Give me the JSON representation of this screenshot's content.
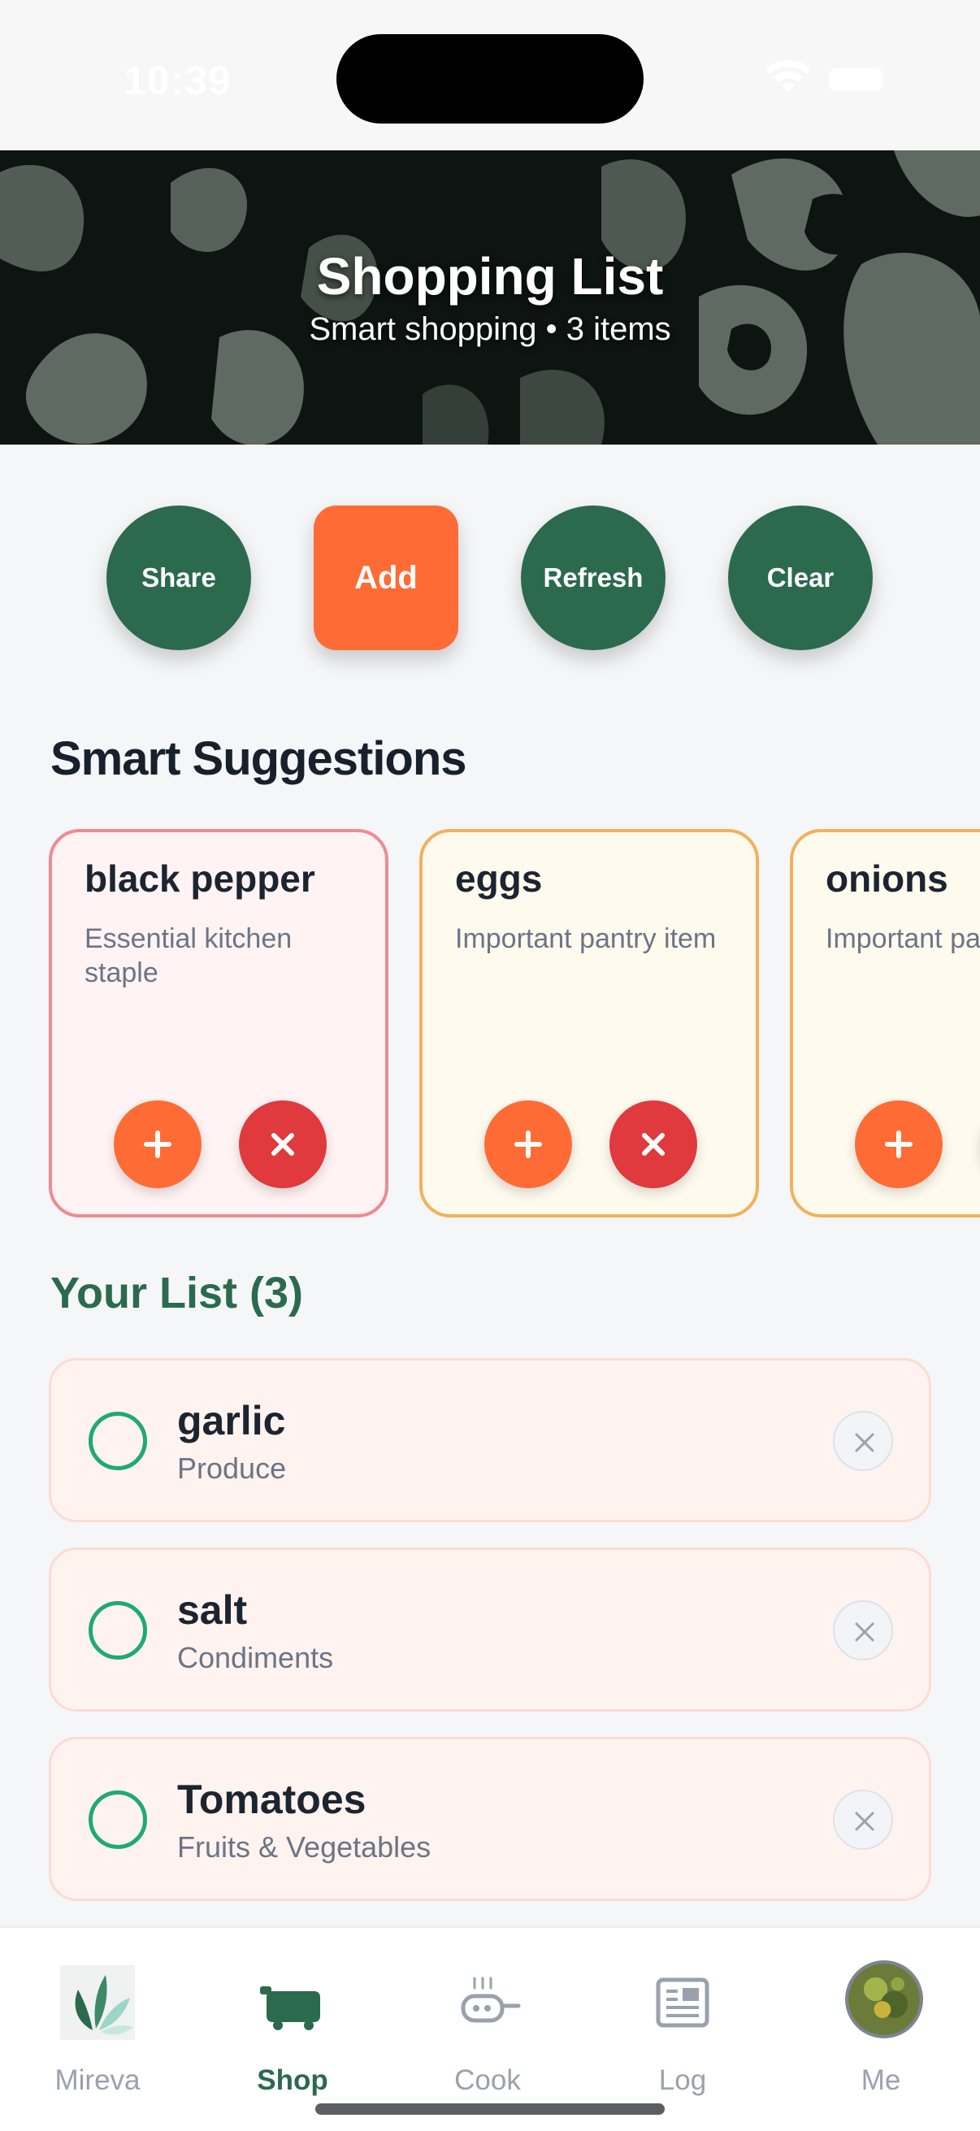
{
  "status_bar": {
    "time": "10:39"
  },
  "header": {
    "title": "Shopping List",
    "subtitle": "Smart shopping • 3 items"
  },
  "actions": [
    {
      "label": "Share"
    },
    {
      "label": "Add"
    },
    {
      "label": "Refresh"
    },
    {
      "label": "Clear"
    }
  ],
  "suggestions": {
    "title": "Smart Suggestions",
    "items": [
      {
        "name": "black pepper",
        "description": "Essential kitchen staple"
      },
      {
        "name": "eggs",
        "description": "Important pantry item"
      },
      {
        "name": "onions",
        "description": "Important pantry item"
      }
    ]
  },
  "list": {
    "title": "Your List (3)",
    "items": [
      {
        "name": "garlic",
        "category": "Produce"
      },
      {
        "name": "salt",
        "category": "Condiments"
      },
      {
        "name": "Tomatoes",
        "category": "Fruits & Vegetables"
      }
    ]
  },
  "tabs": [
    {
      "label": "Mireva",
      "icon": "mireva-logo-icon"
    },
    {
      "label": "Shop",
      "icon": "cart-icon"
    },
    {
      "label": "Cook",
      "icon": "cooking-pot-icon"
    },
    {
      "label": "Log",
      "icon": "newspaper-icon"
    },
    {
      "label": "Me",
      "icon": "avatar-icon"
    }
  ],
  "colors": {
    "primary_green": "#2b6a4d",
    "accent_orange": "#ff6b35",
    "danger_red": "#e0393e",
    "check_green": "#1faa72"
  }
}
